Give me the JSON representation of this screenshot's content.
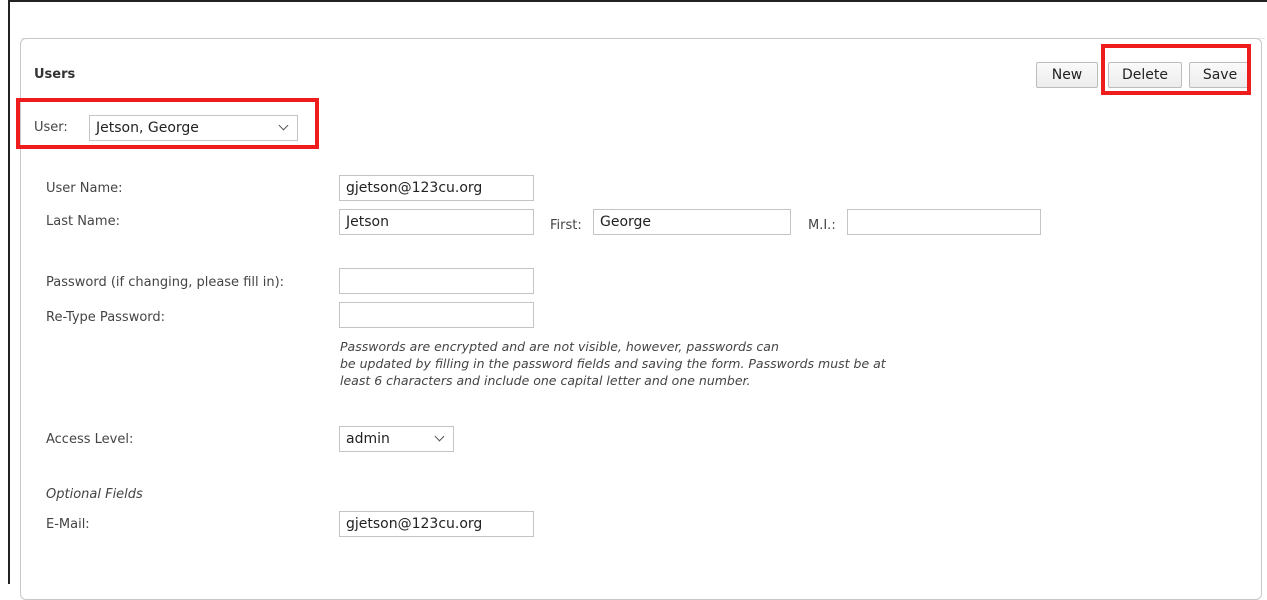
{
  "panel": {
    "title": "Users"
  },
  "toolbar": {
    "new_label": "New",
    "delete_label": "Delete",
    "save_label": "Save"
  },
  "user_select": {
    "label": "User:",
    "value": "Jetson, George"
  },
  "form": {
    "username": {
      "label": "User Name:",
      "value": "gjetson@123cu.org"
    },
    "last_name": {
      "label": "Last Name:",
      "value": "Jetson"
    },
    "first_name": {
      "label": "First:",
      "value": "George"
    },
    "middle_initial": {
      "label": "M.I.:",
      "value": ""
    },
    "password": {
      "label": "Password (if changing, please fill in):",
      "value": ""
    },
    "retype_password": {
      "label": "Re-Type Password:",
      "value": ""
    },
    "password_note": {
      "line1": "Passwords are encrypted and are not visible, however, passwords can",
      "line2": "be updated by filling in the password fields and saving the form. Passwords must be at",
      "line3": "least 6 characters and include one capital letter and one number."
    },
    "access_level": {
      "label": "Access Level:",
      "value": "admin"
    },
    "optional_heading": "Optional Fields",
    "email": {
      "label": "E-Mail:",
      "value": "gjetson@123cu.org"
    }
  },
  "colors": {
    "highlight": "#ee1c1c",
    "border": "#c4c4c4"
  }
}
